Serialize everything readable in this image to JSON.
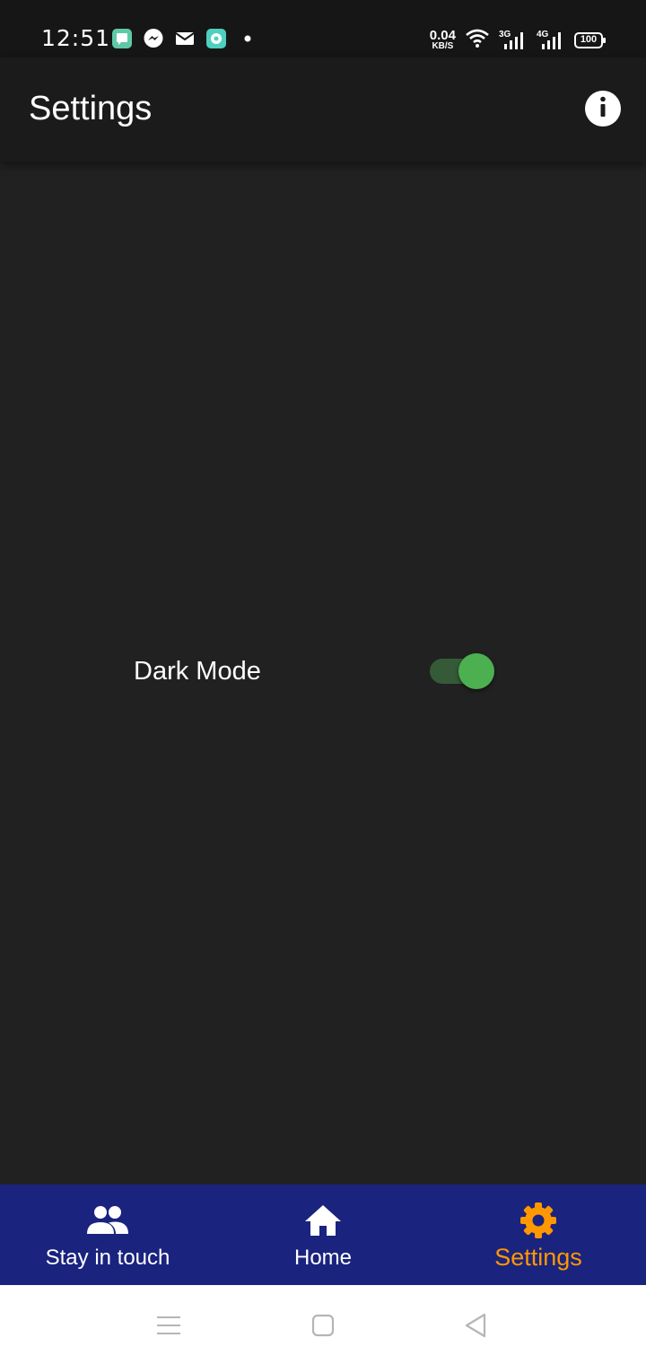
{
  "status_bar": {
    "time": "12:51",
    "notification_icons": [
      "chat-app-icon",
      "messenger-icon",
      "mail-icon",
      "app-notification-icon",
      "dot-icon"
    ],
    "net_speed_value": "0.04",
    "net_speed_unit": "KB/S",
    "signal_1_label": "3G",
    "signal_2_label": "4G",
    "battery": "100"
  },
  "app_bar": {
    "title": "Settings",
    "info_icon": "info-icon"
  },
  "settings": {
    "dark_mode_label": "Dark Mode",
    "dark_mode_enabled": true
  },
  "bottom_nav": {
    "items": [
      {
        "label": "Stay in touch",
        "icon": "people-icon",
        "active": false
      },
      {
        "label": "Home",
        "icon": "home-icon",
        "active": false
      },
      {
        "label": "Settings",
        "icon": "gear-icon",
        "active": true
      }
    ]
  },
  "colors": {
    "background": "#212121",
    "app_bar": "#1b1b1b",
    "bottom_nav": "#1a237e",
    "active_nav": "#ff9800",
    "toggle_on": "#4caf50"
  },
  "system_nav": {
    "buttons": [
      "menu-icon",
      "home-square-icon",
      "back-icon"
    ]
  }
}
